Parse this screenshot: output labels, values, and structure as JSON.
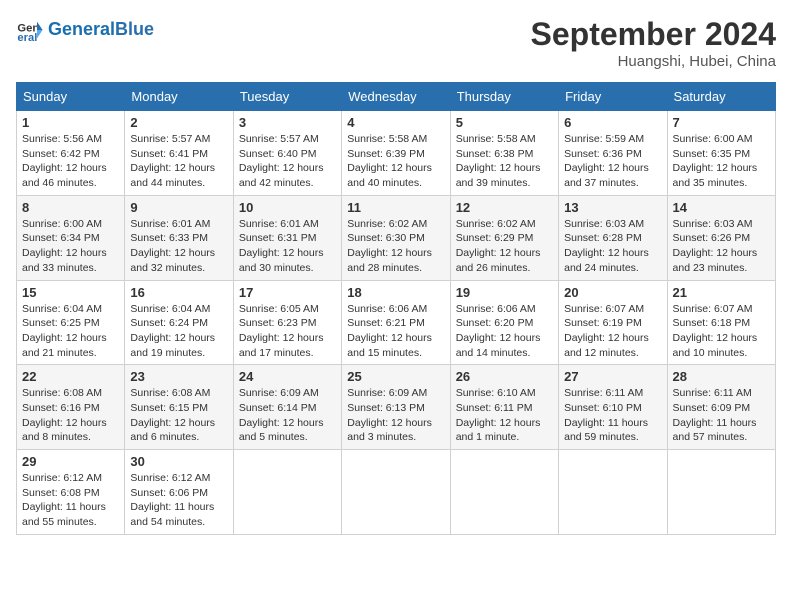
{
  "logo": {
    "text_general": "General",
    "text_blue": "Blue"
  },
  "header": {
    "month_year": "September 2024",
    "location": "Huangshi, Hubei, China"
  },
  "weekdays": [
    "Sunday",
    "Monday",
    "Tuesday",
    "Wednesday",
    "Thursday",
    "Friday",
    "Saturday"
  ],
  "weeks": [
    [
      {
        "day": "1",
        "info": "Sunrise: 5:56 AM\nSunset: 6:42 PM\nDaylight: 12 hours and 46 minutes."
      },
      {
        "day": "2",
        "info": "Sunrise: 5:57 AM\nSunset: 6:41 PM\nDaylight: 12 hours and 44 minutes."
      },
      {
        "day": "3",
        "info": "Sunrise: 5:57 AM\nSunset: 6:40 PM\nDaylight: 12 hours and 42 minutes."
      },
      {
        "day": "4",
        "info": "Sunrise: 5:58 AM\nSunset: 6:39 PM\nDaylight: 12 hours and 40 minutes."
      },
      {
        "day": "5",
        "info": "Sunrise: 5:58 AM\nSunset: 6:38 PM\nDaylight: 12 hours and 39 minutes."
      },
      {
        "day": "6",
        "info": "Sunrise: 5:59 AM\nSunset: 6:36 PM\nDaylight: 12 hours and 37 minutes."
      },
      {
        "day": "7",
        "info": "Sunrise: 6:00 AM\nSunset: 6:35 PM\nDaylight: 12 hours and 35 minutes."
      }
    ],
    [
      {
        "day": "8",
        "info": "Sunrise: 6:00 AM\nSunset: 6:34 PM\nDaylight: 12 hours and 33 minutes."
      },
      {
        "day": "9",
        "info": "Sunrise: 6:01 AM\nSunset: 6:33 PM\nDaylight: 12 hours and 32 minutes."
      },
      {
        "day": "10",
        "info": "Sunrise: 6:01 AM\nSunset: 6:31 PM\nDaylight: 12 hours and 30 minutes."
      },
      {
        "day": "11",
        "info": "Sunrise: 6:02 AM\nSunset: 6:30 PM\nDaylight: 12 hours and 28 minutes."
      },
      {
        "day": "12",
        "info": "Sunrise: 6:02 AM\nSunset: 6:29 PM\nDaylight: 12 hours and 26 minutes."
      },
      {
        "day": "13",
        "info": "Sunrise: 6:03 AM\nSunset: 6:28 PM\nDaylight: 12 hours and 24 minutes."
      },
      {
        "day": "14",
        "info": "Sunrise: 6:03 AM\nSunset: 6:26 PM\nDaylight: 12 hours and 23 minutes."
      }
    ],
    [
      {
        "day": "15",
        "info": "Sunrise: 6:04 AM\nSunset: 6:25 PM\nDaylight: 12 hours and 21 minutes."
      },
      {
        "day": "16",
        "info": "Sunrise: 6:04 AM\nSunset: 6:24 PM\nDaylight: 12 hours and 19 minutes."
      },
      {
        "day": "17",
        "info": "Sunrise: 6:05 AM\nSunset: 6:23 PM\nDaylight: 12 hours and 17 minutes."
      },
      {
        "day": "18",
        "info": "Sunrise: 6:06 AM\nSunset: 6:21 PM\nDaylight: 12 hours and 15 minutes."
      },
      {
        "day": "19",
        "info": "Sunrise: 6:06 AM\nSunset: 6:20 PM\nDaylight: 12 hours and 14 minutes."
      },
      {
        "day": "20",
        "info": "Sunrise: 6:07 AM\nSunset: 6:19 PM\nDaylight: 12 hours and 12 minutes."
      },
      {
        "day": "21",
        "info": "Sunrise: 6:07 AM\nSunset: 6:18 PM\nDaylight: 12 hours and 10 minutes."
      }
    ],
    [
      {
        "day": "22",
        "info": "Sunrise: 6:08 AM\nSunset: 6:16 PM\nDaylight: 12 hours and 8 minutes."
      },
      {
        "day": "23",
        "info": "Sunrise: 6:08 AM\nSunset: 6:15 PM\nDaylight: 12 hours and 6 minutes."
      },
      {
        "day": "24",
        "info": "Sunrise: 6:09 AM\nSunset: 6:14 PM\nDaylight: 12 hours and 5 minutes."
      },
      {
        "day": "25",
        "info": "Sunrise: 6:09 AM\nSunset: 6:13 PM\nDaylight: 12 hours and 3 minutes."
      },
      {
        "day": "26",
        "info": "Sunrise: 6:10 AM\nSunset: 6:11 PM\nDaylight: 12 hours and 1 minute."
      },
      {
        "day": "27",
        "info": "Sunrise: 6:11 AM\nSunset: 6:10 PM\nDaylight: 11 hours and 59 minutes."
      },
      {
        "day": "28",
        "info": "Sunrise: 6:11 AM\nSunset: 6:09 PM\nDaylight: 11 hours and 57 minutes."
      }
    ],
    [
      {
        "day": "29",
        "info": "Sunrise: 6:12 AM\nSunset: 6:08 PM\nDaylight: 11 hours and 55 minutes."
      },
      {
        "day": "30",
        "info": "Sunrise: 6:12 AM\nSunset: 6:06 PM\nDaylight: 11 hours and 54 minutes."
      },
      null,
      null,
      null,
      null,
      null
    ]
  ]
}
